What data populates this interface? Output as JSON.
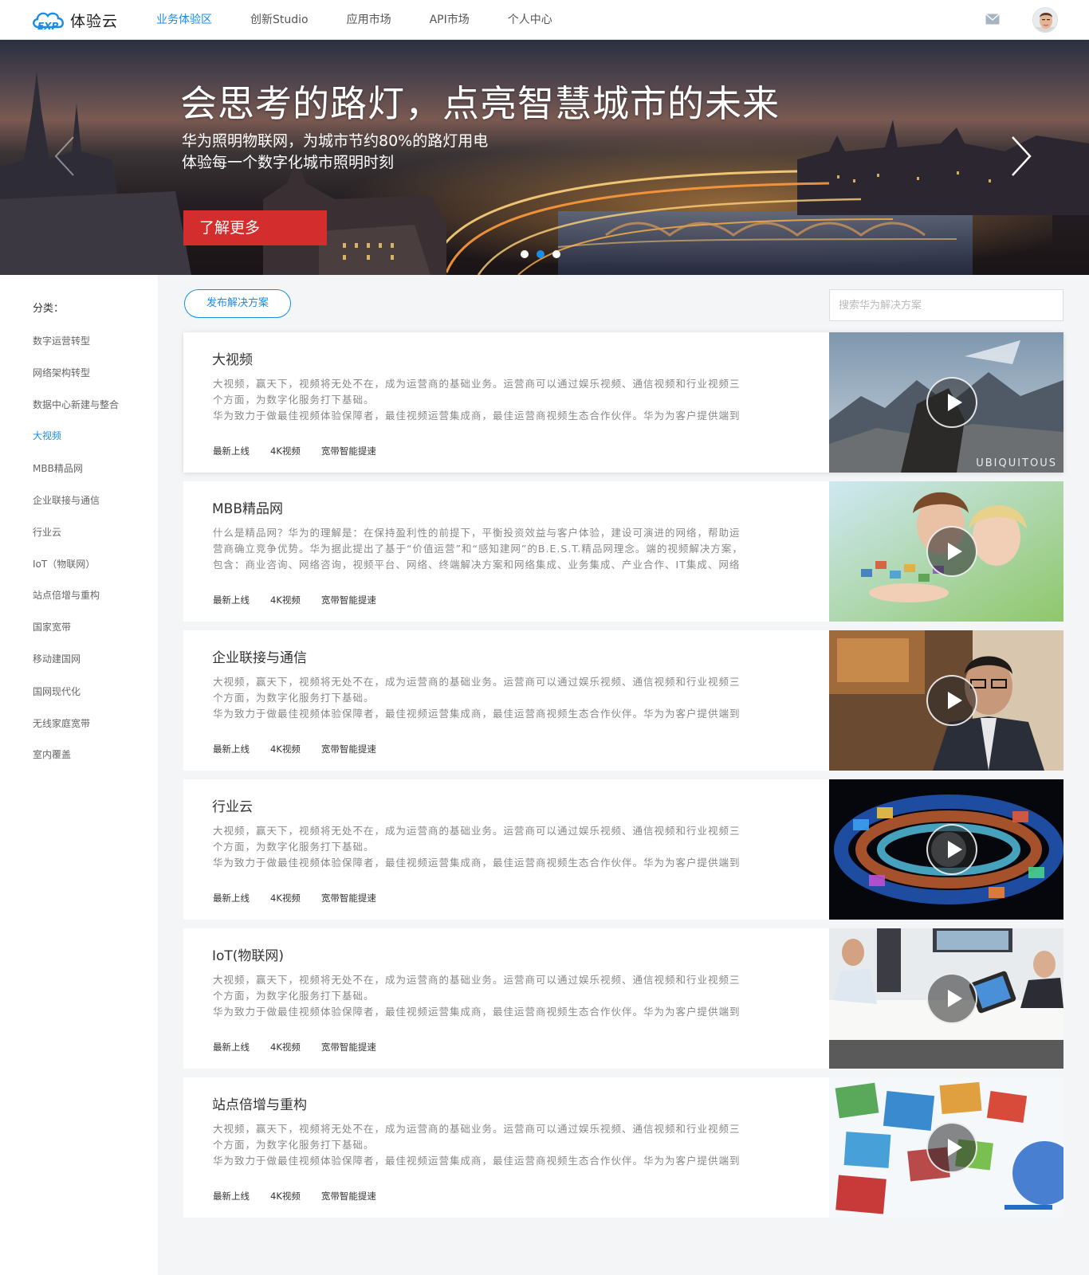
{
  "brand": {
    "name": "体验云",
    "logo_letters": "EXP",
    "accent": "#1a8ce8"
  },
  "nav": {
    "items": [
      {
        "label": "业务体验区",
        "active": true
      },
      {
        "label": "创新Studio",
        "active": false
      },
      {
        "label": "应用市场",
        "active": false
      },
      {
        "label": "API市场",
        "active": false
      },
      {
        "label": "个人中心",
        "active": false
      }
    ]
  },
  "banner": {
    "title": "会思考的路灯，点亮智慧城市的未来",
    "subtitle_1": "华为照明物联网，为城市节约80%的路灯用电",
    "subtitle_2": "体验每一个数字化城市照明时刻",
    "cta_label": "了解更多",
    "cta_color": "#d42d2d",
    "slide_count": 3,
    "active_slide": 2
  },
  "sidebar": {
    "heading": "分类：",
    "items": [
      {
        "label": "数字运营转型"
      },
      {
        "label": "网络架构转型"
      },
      {
        "label": "数据中心新建与整合"
      },
      {
        "label": "大视频",
        "active": true
      },
      {
        "label": "MBB精品网"
      },
      {
        "label": "企业联接与通信"
      },
      {
        "label": "行业云"
      },
      {
        "label": "IoT（物联网）"
      },
      {
        "label": "站点倍增与重构"
      },
      {
        "label": "国家宽带"
      },
      {
        "label": "移动建国网"
      },
      {
        "label": "国网现代化"
      },
      {
        "label": "无线家庭宽带"
      },
      {
        "label": "室内覆盖"
      }
    ]
  },
  "toolbar": {
    "publish_label": "发布解决方案",
    "search_placeholder": "搜索华为解决方案"
  },
  "cards": [
    {
      "title": "大视频",
      "desc_lines": [
        "大视频，赢天下，视频将无处不在，成为运营商的基础业务。运营商可以通过娱乐视频、通信视频和行业视频三",
        "个方面，为数字化服务打下基础。",
        "华为致力于做最佳视频体验保障者，最佳视频运营集成商，最佳运营商视频生态合作伙伴。华为为客户提供端到"
      ],
      "tags": [
        "最新上线",
        "4K视频",
        "宽带智能提速"
      ],
      "watermark": "UBIQUITOUS"
    },
    {
      "title": "MBB精品网",
      "desc_lines": [
        "什么是精品网？华为的理解是：在保持盈利性的前提下，平衡投资效益与客户体验，建设可演进的网络，帮助运",
        "营商确立竞争优势。华为据此提出了基于“价值运营”和“感知建网”的B.E.S.T.精品网理念。端的视频解决方案，",
        "包含：商业咨询、网络咨询，视频平台、网络、终端解决方案和网络集成、业务集成、产业合作、IT集成、网络"
      ],
      "tags": [
        "最新上线",
        "4K视频",
        "宽带智能提速"
      ]
    },
    {
      "title": "企业联接与通信",
      "desc_lines": [
        "大视频，赢天下，视频将无处不在，成为运营商的基础业务。运营商可以通过娱乐视频、通信视频和行业视频三",
        "个方面，为数字化服务打下基础。",
        "华为致力于做最佳视频体验保障者，最佳视频运营集成商，最佳运营商视频生态合作伙伴。华为为客户提供端到"
      ],
      "tags": [
        "最新上线",
        "4K视频",
        "宽带智能提速"
      ]
    },
    {
      "title": "行业云",
      "desc_lines": [
        "大视频，赢天下，视频将无处不在，成为运营商的基础业务。运营商可以通过娱乐视频、通信视频和行业视频三",
        "个方面，为数字化服务打下基础。",
        "华为致力于做最佳视频体验保障者，最佳视频运营集成商，最佳运营商视频生态合作伙伴。华为为客户提供端到"
      ],
      "tags": [
        "最新上线",
        "4K视频",
        "宽带智能提速"
      ]
    },
    {
      "title": "IoT(物联网)",
      "desc_lines": [
        "大视频，赢天下，视频将无处不在，成为运营商的基础业务。运营商可以通过娱乐视频、通信视频和行业视频三",
        "个方面，为数字化服务打下基础。",
        "华为致力于做最佳视频体验保障者，最佳视频运营集成商，最佳运营商视频生态合作伙伴。华为为客户提供端到"
      ],
      "tags": [
        "最新上线",
        "4K视频",
        "宽带智能提速"
      ]
    },
    {
      "title": "站点倍增与重构",
      "desc_lines": [
        "大视频，赢天下，视频将无处不在，成为运营商的基础业务。运营商可以通过娱乐视频、通信视频和行业视频三",
        "个方面，为数字化服务打下基础。",
        "华为致力于做最佳视频体验保障者，最佳视频运营集成商，最佳运营商视频生态合作伙伴。华为为客户提供端到"
      ],
      "tags": [
        "最新上线",
        "4K视频",
        "宽带智能提速"
      ]
    }
  ]
}
